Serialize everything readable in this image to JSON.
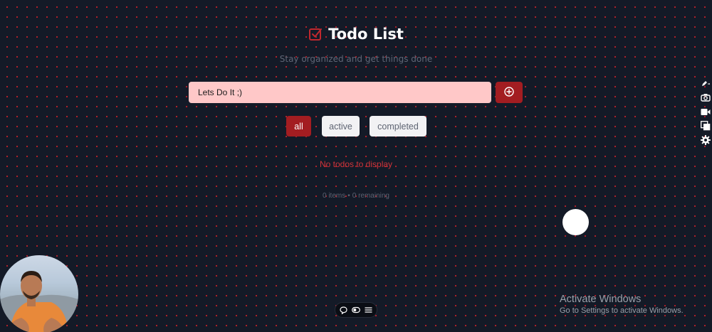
{
  "header": {
    "title": "Todo List",
    "subtitle": "Stay organized and get things done",
    "icon": "checkbox-icon"
  },
  "input": {
    "value": "Lets Do It ;)",
    "add_icon": "plus-circle-icon"
  },
  "filters": [
    {
      "label": "all",
      "active": true
    },
    {
      "label": "active",
      "active": false
    },
    {
      "label": "completed",
      "active": false
    }
  ],
  "empty_message": "No todos to display",
  "counter": {
    "items": "0 items",
    "separator": "•",
    "remaining": "0 remaining"
  },
  "side_toolbar": [
    "pen-icon",
    "camera-icon",
    "video-icon",
    "windows-icon",
    "gear-icon"
  ],
  "bottom_toolbar": [
    "comment-icon",
    "toggle-icon",
    "menu-icon"
  ],
  "activation": {
    "heading": "Activate Windows",
    "detail": "Go to Settings to activate Windows."
  },
  "colors": {
    "background": "#141a27",
    "accent": "#a31d21",
    "input_bg": "#ffc8c8",
    "empty_text": "#d0343a"
  }
}
